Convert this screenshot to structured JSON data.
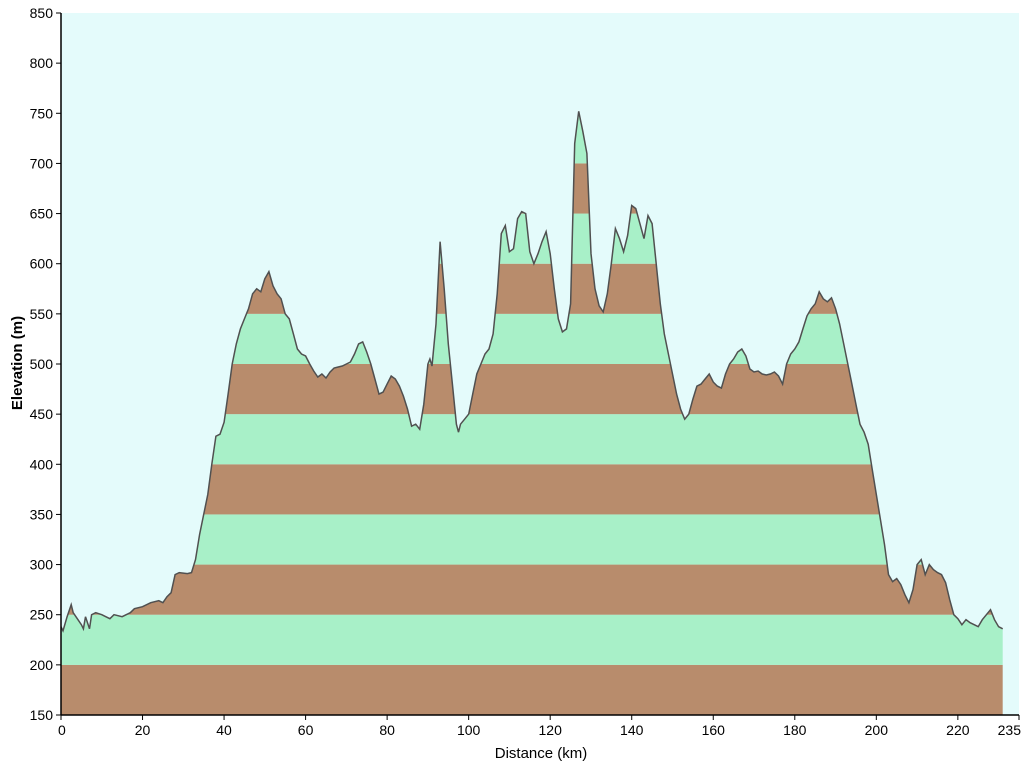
{
  "chart_data": {
    "type": "area",
    "xlabel": "Distance   (km)",
    "ylabel": "Elevation (m)",
    "xlim": [
      0,
      235
    ],
    "ylim": [
      150,
      850
    ],
    "x_ticks": [
      0,
      20,
      40,
      60,
      80,
      100,
      120,
      140,
      160,
      180,
      200,
      220,
      235
    ],
    "y_ticks": [
      150,
      200,
      250,
      300,
      350,
      400,
      450,
      500,
      550,
      600,
      650,
      700,
      750,
      800,
      850
    ],
    "band_size_m": 50,
    "colors": {
      "background": "#e4fbfb",
      "band_brown": "#b88c6c",
      "band_green": "#a8f0c8",
      "profile_line": "#505050",
      "axis": "#000000"
    },
    "grid": false,
    "profile": [
      [
        0,
        238
      ],
      [
        0.5,
        234
      ],
      [
        1.5,
        248
      ],
      [
        2.5,
        260
      ],
      [
        3,
        252
      ],
      [
        4,
        246
      ],
      [
        5,
        240
      ],
      [
        5.5,
        236
      ],
      [
        6,
        248
      ],
      [
        7,
        236
      ],
      [
        7.5,
        250
      ],
      [
        8.5,
        252
      ],
      [
        10,
        250
      ],
      [
        11,
        248
      ],
      [
        12,
        246
      ],
      [
        13,
        250
      ],
      [
        15,
        248
      ],
      [
        16,
        250
      ],
      [
        17,
        252
      ],
      [
        18,
        256
      ],
      [
        20,
        258
      ],
      [
        22,
        262
      ],
      [
        24,
        264
      ],
      [
        25,
        262
      ],
      [
        26,
        268
      ],
      [
        27,
        272
      ],
      [
        28,
        290
      ],
      [
        29,
        292
      ],
      [
        31,
        291
      ],
      [
        32,
        292
      ],
      [
        33,
        305
      ],
      [
        34,
        330
      ],
      [
        35,
        350
      ],
      [
        36,
        370
      ],
      [
        37,
        400
      ],
      [
        38,
        428
      ],
      [
        39,
        430
      ],
      [
        40,
        442
      ],
      [
        41,
        470
      ],
      [
        42,
        500
      ],
      [
        43,
        520
      ],
      [
        44,
        535
      ],
      [
        45,
        545
      ],
      [
        46,
        555
      ],
      [
        47,
        570
      ],
      [
        48,
        575
      ],
      [
        49,
        572
      ],
      [
        50,
        585
      ],
      [
        51,
        592
      ],
      [
        52,
        578
      ],
      [
        53,
        570
      ],
      [
        54,
        565
      ],
      [
        55,
        550
      ],
      [
        56,
        545
      ],
      [
        57,
        530
      ],
      [
        58,
        515
      ],
      [
        59,
        510
      ],
      [
        60,
        508
      ],
      [
        61,
        500
      ],
      [
        62,
        493
      ],
      [
        63,
        487
      ],
      [
        64,
        490
      ],
      [
        65,
        486
      ],
      [
        66,
        492
      ],
      [
        67,
        496
      ],
      [
        68,
        497
      ],
      [
        69,
        498
      ],
      [
        70,
        500
      ],
      [
        71,
        502
      ],
      [
        72,
        510
      ],
      [
        73,
        520
      ],
      [
        74,
        522
      ],
      [
        75,
        512
      ],
      [
        76,
        500
      ],
      [
        77,
        485
      ],
      [
        78,
        470
      ],
      [
        79,
        472
      ],
      [
        80,
        480
      ],
      [
        81,
        488
      ],
      [
        82,
        485
      ],
      [
        83,
        478
      ],
      [
        84,
        468
      ],
      [
        85,
        455
      ],
      [
        86,
        438
      ],
      [
        87,
        440
      ],
      [
        88,
        435
      ],
      [
        89,
        460
      ],
      [
        90,
        500
      ],
      [
        90.5,
        505
      ],
      [
        91,
        498
      ],
      [
        92,
        540
      ],
      [
        93,
        622
      ],
      [
        94,
        575
      ],
      [
        95,
        520
      ],
      [
        96,
        480
      ],
      [
        97,
        440
      ],
      [
        97.5,
        432
      ],
      [
        98,
        440
      ],
      [
        99,
        445
      ],
      [
        100,
        450
      ],
      [
        101,
        470
      ],
      [
        102,
        490
      ],
      [
        103,
        500
      ],
      [
        104,
        510
      ],
      [
        105,
        515
      ],
      [
        106,
        530
      ],
      [
        107,
        570
      ],
      [
        108,
        630
      ],
      [
        109,
        638
      ],
      [
        110,
        612
      ],
      [
        111,
        615
      ],
      [
        112,
        645
      ],
      [
        113,
        652
      ],
      [
        114,
        650
      ],
      [
        115,
        612
      ],
      [
        116,
        600
      ],
      [
        117,
        610
      ],
      [
        118,
        622
      ],
      [
        119,
        632
      ],
      [
        120,
        610
      ],
      [
        121,
        575
      ],
      [
        122,
        545
      ],
      [
        123,
        532
      ],
      [
        124,
        535
      ],
      [
        125,
        560
      ],
      [
        126,
        720
      ],
      [
        127,
        752
      ],
      [
        128,
        732
      ],
      [
        129,
        710
      ],
      [
        130,
        610
      ],
      [
        131,
        575
      ],
      [
        132,
        558
      ],
      [
        133,
        552
      ],
      [
        134,
        570
      ],
      [
        135,
        600
      ],
      [
        136,
        635
      ],
      [
        137,
        625
      ],
      [
        138,
        612
      ],
      [
        139,
        628
      ],
      [
        140,
        658
      ],
      [
        141,
        655
      ],
      [
        142,
        640
      ],
      [
        143,
        625
      ],
      [
        144,
        648
      ],
      [
        145,
        640
      ],
      [
        146,
        600
      ],
      [
        147,
        560
      ],
      [
        148,
        530
      ],
      [
        149,
        510
      ],
      [
        150,
        490
      ],
      [
        151,
        470
      ],
      [
        152,
        455
      ],
      [
        153,
        445
      ],
      [
        154,
        450
      ],
      [
        155,
        465
      ],
      [
        156,
        478
      ],
      [
        157,
        480
      ],
      [
        158,
        485
      ],
      [
        159,
        490
      ],
      [
        160,
        482
      ],
      [
        161,
        478
      ],
      [
        162,
        476
      ],
      [
        163,
        490
      ],
      [
        164,
        500
      ],
      [
        165,
        505
      ],
      [
        166,
        512
      ],
      [
        167,
        515
      ],
      [
        168,
        508
      ],
      [
        169,
        495
      ],
      [
        170,
        492
      ],
      [
        171,
        493
      ],
      [
        172,
        490
      ],
      [
        173,
        489
      ],
      [
        174,
        490
      ],
      [
        175,
        492
      ],
      [
        176,
        488
      ],
      [
        177,
        480
      ],
      [
        178,
        500
      ],
      [
        179,
        510
      ],
      [
        180,
        515
      ],
      [
        181,
        522
      ],
      [
        182,
        535
      ],
      [
        183,
        548
      ],
      [
        184,
        555
      ],
      [
        185,
        560
      ],
      [
        186,
        572
      ],
      [
        187,
        565
      ],
      [
        188,
        562
      ],
      [
        189,
        566
      ],
      [
        190,
        555
      ],
      [
        191,
        540
      ],
      [
        192,
        520
      ],
      [
        193,
        500
      ],
      [
        194,
        480
      ],
      [
        195,
        460
      ],
      [
        196,
        440
      ],
      [
        197,
        432
      ],
      [
        198,
        420
      ],
      [
        199,
        395
      ],
      [
        200,
        370
      ],
      [
        201,
        345
      ],
      [
        202,
        320
      ],
      [
        203,
        290
      ],
      [
        204,
        283
      ],
      [
        205,
        286
      ],
      [
        206,
        280
      ],
      [
        207,
        270
      ],
      [
        208,
        262
      ],
      [
        209,
        275
      ],
      [
        210,
        300
      ],
      [
        211,
        305
      ],
      [
        212,
        290
      ],
      [
        213,
        300
      ],
      [
        214,
        295
      ],
      [
        215,
        292
      ],
      [
        216,
        290
      ],
      [
        217,
        282
      ],
      [
        218,
        265
      ],
      [
        219,
        250
      ],
      [
        220,
        246
      ],
      [
        221,
        240
      ],
      [
        222,
        245
      ],
      [
        223,
        242
      ],
      [
        224,
        240
      ],
      [
        225,
        238
      ],
      [
        226,
        245
      ],
      [
        227,
        250
      ],
      [
        228,
        255
      ],
      [
        229,
        245
      ],
      [
        230,
        238
      ],
      [
        231,
        236
      ]
    ]
  }
}
